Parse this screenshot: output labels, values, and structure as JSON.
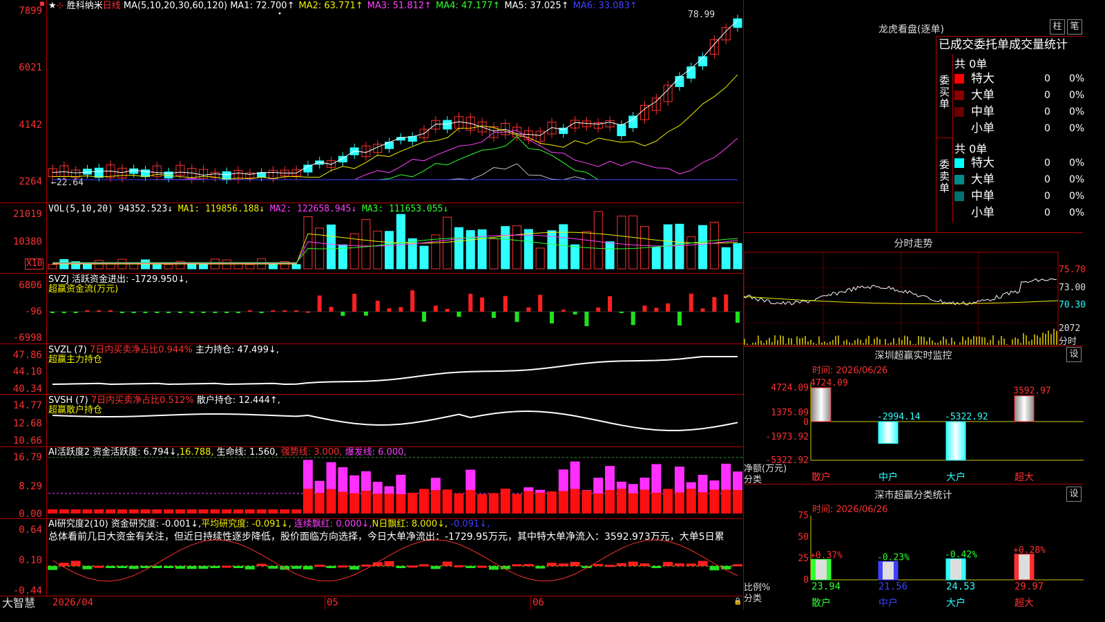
{
  "stock": {
    "name": "胜科纳米",
    "period": "日线",
    "ma_title": "MA(5,10,20,30,60,120)",
    "ma": [
      {
        "label": "MA1:",
        "value": "72.700↑",
        "color": "#ffffff"
      },
      {
        "label": "MA2:",
        "value": "63.771↑",
        "color": "#f0f000"
      },
      {
        "label": "MA3:",
        "value": "51.812↑",
        "color": "#ff40ff"
      },
      {
        "label": "MA4:",
        "value": "47.177↑",
        "color": "#30ff30"
      },
      {
        "label": "MA5:",
        "value": "37.025↑",
        "color": "#ffffff"
      },
      {
        "label": "MA6:",
        "value": "33.083↑",
        "color": "#4040ff"
      }
    ],
    "high_label": "78.99",
    "low_label": "←22.64"
  },
  "price_axis": [
    "7899",
    "6021",
    "4142",
    "2264"
  ],
  "vol": {
    "title": "VOL(5,10,20)",
    "value": "94352.523↓",
    "ma1": "MA1: 119856.188↓",
    "ma2": "MA2: 122658.945↓",
    "ma3": "MA3: 111653.055↓",
    "axis": [
      "21019",
      "10380"
    ],
    "unit": "X10"
  },
  "svzj": {
    "title": "SVZJ  活跃资金进出:",
    "value": "-1729.950↓,",
    "sub": "超赢资金流(万元)",
    "axis": [
      "6806",
      "-96",
      "-6998"
    ]
  },
  "svzl": {
    "title": "SVZL  (7)",
    "ratio": "7日内买卖净占比0.944%",
    "hold": "主力持仓: 47.499↓,",
    "sub": "超赢主力持仓",
    "axis": [
      "47.86",
      "44.10",
      "40.34"
    ]
  },
  "svsh": {
    "title": "SVSH  (7)",
    "ratio": "7日内买卖净占比0.512%",
    "hold": "散户持仓: 12.444↑,",
    "sub": "超赢散户持仓",
    "axis": [
      "14.77",
      "12.68",
      "10.66"
    ]
  },
  "ai1": {
    "title": "AI活跃度2",
    "a": "资金活跃度: 6.794↓,",
    "b": "16.788,",
    "c": "生命线: 1.560,",
    "d": "强势线: 3.000,",
    "e": "爆发线: 6.000,",
    "axis": [
      "16.79",
      "8.29",
      "0.00"
    ]
  },
  "ai2": {
    "title": "AI研究度2(10)",
    "a": "资金研究度: -0.001↓,",
    "b": "平均研究度: -0.091↓,",
    "c": "连续飘红: 0.000↓,",
    "d": "N日飘红: 8.000↓,",
    "e": "-0.091↓,",
    "axis": [
      "0.64",
      "0.10",
      "-0.44"
    ],
    "summary": "总体看前几日大资金有关注，但近日持续性逐步降低，股价面临方向选择，今日大单净流出：-1729.95万元，其中特大单净流入：3592.973万元，大单5日累"
  },
  "bottom": {
    "brand": "大智慧",
    "dates": [
      "2026/04",
      "05",
      "06"
    ]
  },
  "dragon": {
    "title": "龙虎看盘(逐单)",
    "btn1": "柱",
    "btn2": "笔",
    "tab": "已成交委托单成交量统计",
    "buy": {
      "label": "委买单",
      "total": "共 0单",
      "rows": [
        {
          "name": "特大",
          "v": "0",
          "p": "0%",
          "color": "#ff0000"
        },
        {
          "name": "大单",
          "v": "0",
          "p": "0%",
          "color": "#8b0000"
        },
        {
          "name": "中单",
          "v": "0",
          "p": "0%",
          "color": "#6b0000"
        },
        {
          "name": "小单",
          "v": "0",
          "p": "0%",
          "color": "#000000"
        }
      ]
    },
    "sell": {
      "label": "委卖单",
      "total": "共 0单",
      "rows": [
        {
          "name": "特大",
          "v": "0",
          "p": "0%",
          "color": "#00ffff"
        },
        {
          "name": "大单",
          "v": "0",
          "p": "0%",
          "color": "#008b8b"
        },
        {
          "name": "中单",
          "v": "0",
          "p": "0%",
          "color": "#007070"
        },
        {
          "name": "小单",
          "v": "0",
          "p": "0%",
          "color": "#000000"
        }
      ]
    }
  },
  "intraday": {
    "title": "分时走势",
    "axis": [
      "75.70",
      "73.00",
      "70.30"
    ],
    "vol_label": "2072",
    "unit": "分时"
  },
  "monitor": {
    "title": "深圳超赢实时监控",
    "btn": "设",
    "time": "时间: 2026/06/26",
    "axis": [
      "4724.09",
      "1375.09",
      "0",
      "-1973.92",
      "-5322.92"
    ],
    "bars": [
      {
        "cat": "散户",
        "value": 4724.09,
        "label": "4724.09"
      },
      {
        "cat": "中户",
        "value": -2994.14,
        "label": "-2994.14"
      },
      {
        "cat": "大户",
        "value": -5322.92,
        "label": "-5322.92"
      },
      {
        "cat": "超大",
        "value": 3592.97,
        "label": "3592.97"
      }
    ],
    "ylabel": "净额(万元)",
    "xlabel": "分类"
  },
  "classify": {
    "title": "深市超赢分类统计",
    "btn": "设",
    "time": "时间: 2026/06/26",
    "axis": [
      "75",
      "50",
      "25",
      "0"
    ],
    "bars": [
      {
        "cat": "散户",
        "value": 23.94,
        "change": "+0.37%"
      },
      {
        "cat": "中户",
        "value": 21.56,
        "change": "-0.23%"
      },
      {
        "cat": "大户",
        "value": 24.53,
        "change": "-0.42%"
      },
      {
        "cat": "超大",
        "value": 29.97,
        "change": "+0.28%"
      }
    ],
    "ylabel": "比例%",
    "xlabel": "分类"
  }
}
